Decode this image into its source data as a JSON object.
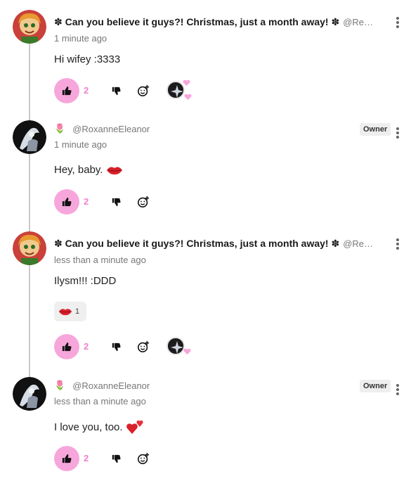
{
  "comments": [
    {
      "author_name": "✽ Can you believe it guys?! Christmas, just a month away! ✽",
      "handle": "@Re…",
      "time": "1 minute ago",
      "text": "Hi wifey :3333",
      "like_count": "2",
      "liked": true,
      "reactors": [
        "heart-icon",
        "heart-icon"
      ]
    },
    {
      "author_name": "🌷",
      "handle": "@RoxanneEleanor",
      "badge": "Owner",
      "time": "1 minute ago",
      "text": "Hey, baby.",
      "inline_emoji": "kiss-lips-icon",
      "like_count": "2",
      "liked": true
    },
    {
      "author_name": "✽ Can you believe it guys?! Christmas, just a month away! ✽",
      "handle": "@Re…",
      "time": "less than a minute ago",
      "text": "Ilysm!!! :DDD",
      "reaction": {
        "emoji": "kiss-lips-icon",
        "count": "1"
      },
      "like_count": "2",
      "liked": true,
      "reactors": [
        "heart-icon"
      ]
    },
    {
      "author_name": "🌷",
      "handle": "@RoxanneEleanor",
      "badge": "Owner",
      "time": "less than a minute ago",
      "text": "I love you, too.",
      "inline_emoji": "two-hearts-icon",
      "like_count": "2",
      "liked": true
    }
  ],
  "colors": {
    "accent_pink": "#f7a6dc",
    "count_pink": "#f07fce",
    "thread_line": "#c9c9c9",
    "muted_text": "#777777"
  }
}
